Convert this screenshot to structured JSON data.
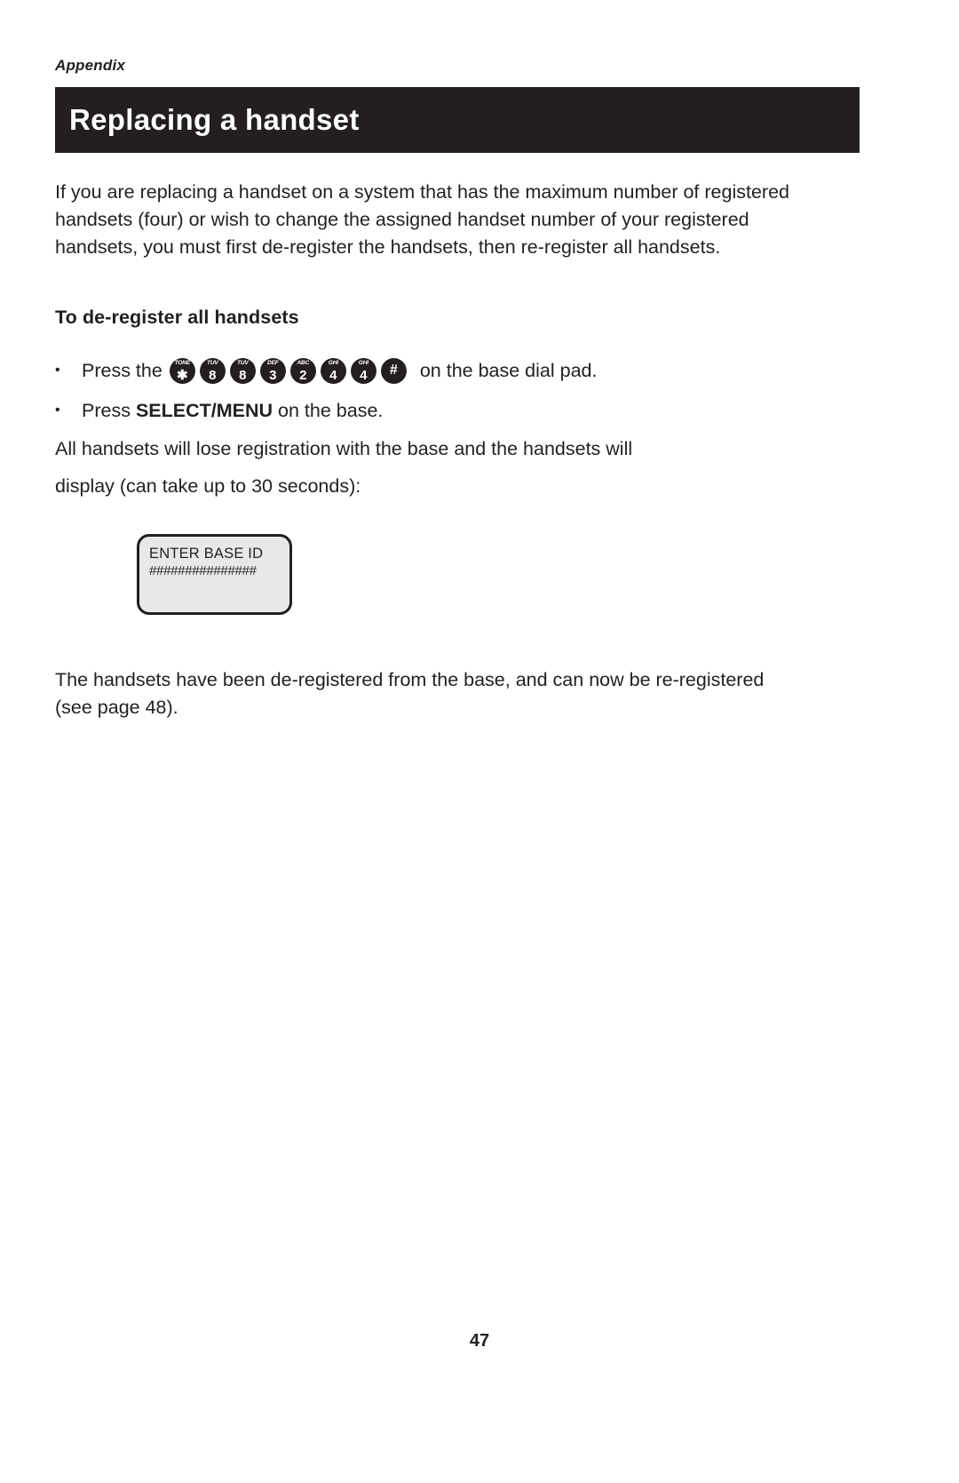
{
  "running_head": "Appendix",
  "title_banner": {
    "title": "Replacing a handset"
  },
  "intro": {
    "line1": "If you are replacing a handset on a system that has the maximum number of registered",
    "line2": "handsets (four) or wish to change the assigned handset number of your registered",
    "line3": "handsets, you must first de-register the handsets, then re-register all handsets."
  },
  "section_heading": "To de-register all handsets",
  "bullets": {
    "keys_bullet": {
      "dot": "•",
      "prefix": "Press the",
      "suffix": "on the base dial pad.",
      "keys": [
        {
          "sub": "TONE",
          "main": "✱"
        },
        {
          "sub": "TUV",
          "main": "8"
        },
        {
          "sub": "TUV",
          "main": "8"
        },
        {
          "sub": "DEF",
          "main": "3"
        },
        {
          "sub": "ABC",
          "main": "2"
        },
        {
          "sub": "GHI",
          "main": "4"
        },
        {
          "sub": "GHI",
          "main": "4"
        },
        {
          "sub": "",
          "main": "#"
        }
      ]
    },
    "select_bullet": {
      "dot": "•",
      "prefix": "Press",
      "strong": "SELECT/MENU",
      "suffix": "on the base."
    }
  },
  "mid_text": {
    "line1": "All handsets will lose registration with the base and the handsets will",
    "line2": "display (can take up to 30 seconds):"
  },
  "lcd": {
    "line1": "ENTER BASE ID",
    "line2": "###############"
  },
  "closing": {
    "line1": "The handsets have been de-registered from the base, and can now be re-registered",
    "line2": "(see page 48)."
  },
  "page_number": "47",
  "colors": {
    "ink": "#231f20",
    "banner_bg": "#231f20",
    "banner_text": "#ffffff",
    "lcd_bg": "#e8e8e8"
  }
}
